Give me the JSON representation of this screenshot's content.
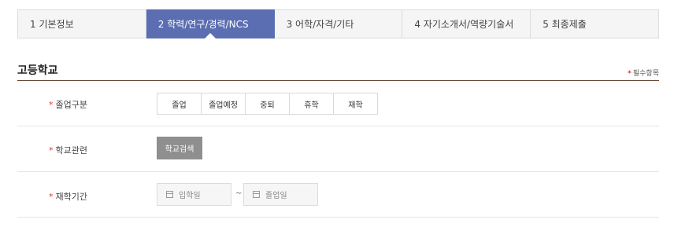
{
  "steps": [
    {
      "label": "1  기본정보",
      "active": false
    },
    {
      "label": "2  학력/연구/경력/NCS",
      "active": true
    },
    {
      "label": "3  어학/자격/기타",
      "active": false
    },
    {
      "label": "4  자기소개서/역량기술서",
      "active": false
    },
    {
      "label": "5  최종제출",
      "active": false
    }
  ],
  "section": {
    "title": "고등학교",
    "required_note": "필수항목",
    "required_star": "*"
  },
  "fields": {
    "graduation": {
      "label": "졸업구분",
      "options": [
        "졸업",
        "졸업예정",
        "중퇴",
        "휴학",
        "재학"
      ]
    },
    "school": {
      "label": "학교관련",
      "button": "학교검색"
    },
    "period": {
      "label": "재학기간",
      "start_placeholder": "입학일",
      "end_placeholder": "졸업일",
      "separator": "~"
    }
  },
  "colors": {
    "active_step": "#5b6eb2",
    "required_star": "#e03a3a",
    "search_button": "#8f8f8f"
  }
}
